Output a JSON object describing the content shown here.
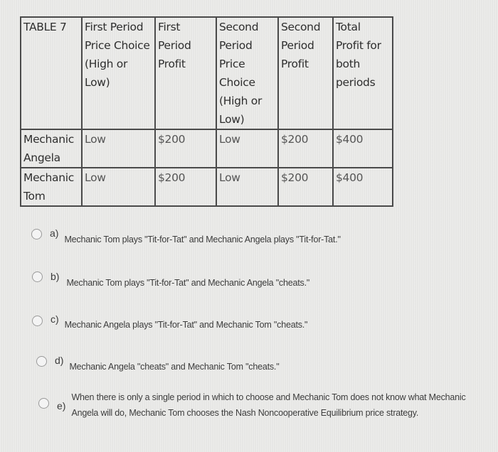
{
  "table": {
    "caption": "TABLE 7",
    "headers": [
      "TABLE 7",
      "First Period Price Choice (High or Low)",
      "First Period Profit",
      "Second Period Price Choice (High or Low)",
      "Second Period Profit",
      "Total Profit for both periods"
    ],
    "rows": [
      {
        "player": "Mechanic Angela",
        "first_price_choice": "Low",
        "first_profit": "$200",
        "second_price_choice": "Low",
        "second_profit": "$200",
        "total_profit": "$400"
      },
      {
        "player": "Mechanic Tom",
        "first_price_choice": "Low",
        "first_profit": "$200",
        "second_price_choice": "Low",
        "second_profit": "$200",
        "total_profit": "$400"
      }
    ]
  },
  "options": [
    {
      "letter": "a)",
      "text": "Mechanic Tom plays \"Tit-for-Tat\" and Mechanic Angela plays \"Tit-for-Tat.\"",
      "selected": false
    },
    {
      "letter": "b)",
      "text": "Mechanic Tom plays \"Tit-for-Tat\" and Mechanic Angela \"cheats.\"",
      "selected": false
    },
    {
      "letter": "c)",
      "text": "Mechanic Angela plays \"Tit-for-Tat\" and Mechanic Tom \"cheats.\"",
      "selected": false
    },
    {
      "letter": "d)",
      "text": "Mechanic Angela \"cheats\" and Mechanic Tom \"cheats.\"",
      "selected": false
    },
    {
      "letter": "e)",
      "text": "When there is only a single period in which to choose and Mechanic Tom does not know what Mechanic Angela will do, Mechanic Tom chooses the Nash Noncooperative Equilibrium price strategy.",
      "selected": false
    }
  ]
}
